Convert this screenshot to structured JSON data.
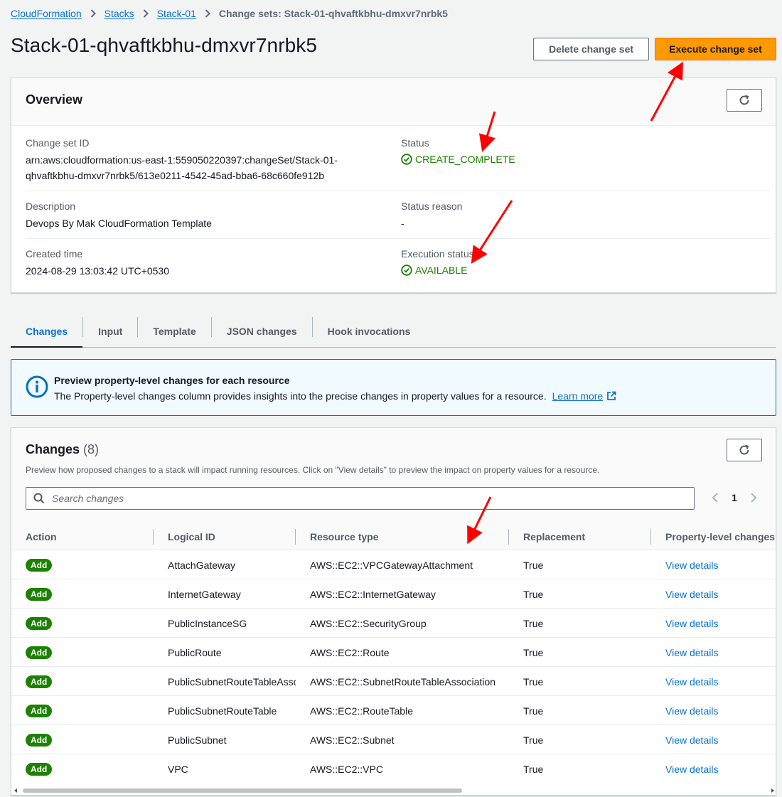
{
  "breadcrumb": {
    "items": [
      "CloudFormation",
      "Stacks",
      "Stack-01"
    ],
    "current": "Change sets: Stack-01-qhvaftkbhu-dmxvr7nrbk5"
  },
  "page": {
    "title": "Stack-01-qhvaftkbhu-dmxvr7nrbk5",
    "delete_label": "Delete change set",
    "execute_label": "Execute change set"
  },
  "overview": {
    "title": "Overview",
    "change_set_id_label": "Change set ID",
    "change_set_id_line1": "arn:aws:cloudformation:us-east-1:559050220397:changeSet/Stack-01-",
    "change_set_id_line2": "qhvaftkbhu-dmxvr7nrbk5/613e0211-4542-45ad-bba6-68c660fe912b",
    "status_label": "Status",
    "status_value": "CREATE_COMPLETE",
    "description_label": "Description",
    "description_value": "Devops By Mak CloudFormation Template",
    "status_reason_label": "Status reason",
    "status_reason_value": "-",
    "created_time_label": "Created time",
    "created_time_value": "2024-08-29 13:03:42 UTC+0530",
    "execution_status_label": "Execution status",
    "execution_status_value": "AVAILABLE"
  },
  "tabs": [
    "Changes",
    "Input",
    "Template",
    "JSON changes",
    "Hook invocations"
  ],
  "alert": {
    "title": "Preview property-level changes for each resource",
    "body": "The Property-level changes column provides insights into the precise changes in property values for a resource.",
    "link": "Learn more"
  },
  "changes": {
    "title": "Changes",
    "count": "(8)",
    "description": "Preview how proposed changes to a stack will impact running resources. Click on \"View details\" to preview the impact on property values for a resource.",
    "search_placeholder": "Search changes",
    "page": "1",
    "columns": [
      "Action",
      "Logical ID",
      "Resource type",
      "Replacement",
      "Property-level changes"
    ],
    "rows": [
      {
        "action": "Add",
        "logical_id": "AttachGateway",
        "resource_type": "AWS::EC2::VPCGatewayAttachment",
        "replacement": "True",
        "details": "View details"
      },
      {
        "action": "Add",
        "logical_id": "InternetGateway",
        "resource_type": "AWS::EC2::InternetGateway",
        "replacement": "True",
        "details": "View details"
      },
      {
        "action": "Add",
        "logical_id": "PublicInstanceSG",
        "resource_type": "AWS::EC2::SecurityGroup",
        "replacement": "True",
        "details": "View details"
      },
      {
        "action": "Add",
        "logical_id": "PublicRoute",
        "resource_type": "AWS::EC2::Route",
        "replacement": "True",
        "details": "View details"
      },
      {
        "action": "Add",
        "logical_id": "PublicSubnetRouteTableAssociation",
        "resource_type": "AWS::EC2::SubnetRouteTableAssociation",
        "replacement": "True",
        "details": "View details"
      },
      {
        "action": "Add",
        "logical_id": "PublicSubnetRouteTable",
        "resource_type": "AWS::EC2::RouteTable",
        "replacement": "True",
        "details": "View details"
      },
      {
        "action": "Add",
        "logical_id": "PublicSubnet",
        "resource_type": "AWS::EC2::Subnet",
        "replacement": "True",
        "details": "View details"
      },
      {
        "action": "Add",
        "logical_id": "VPC",
        "resource_type": "AWS::EC2::VPC",
        "replacement": "True",
        "details": "View details"
      }
    ]
  },
  "colors": {
    "accent": "#0972d3",
    "primary_button": "#ff9900",
    "success": "#1d8102",
    "annotation_arrow": "#ff0000"
  }
}
